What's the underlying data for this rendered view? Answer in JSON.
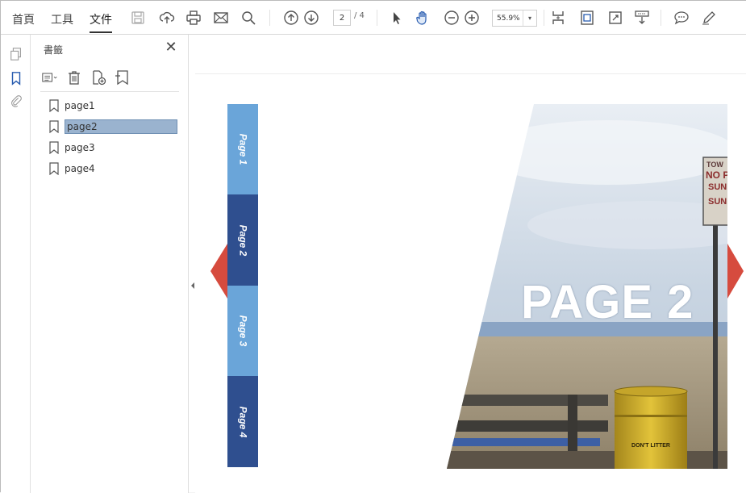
{
  "toolbar": {
    "tabs": [
      {
        "label": "首頁"
      },
      {
        "label": "工具"
      },
      {
        "label": "文件"
      }
    ],
    "page_current": "2",
    "page_total": "/ 4",
    "zoom": "55.9%",
    "icons": [
      "save-icon",
      "upload-icon",
      "print-icon",
      "mail-icon",
      "search-icon",
      "prev-page-icon",
      "next-page-icon",
      "select-cursor-icon",
      "hand-tool-icon",
      "zoom-out-icon",
      "zoom-in-icon",
      "fit-page-icon",
      "fit-width-icon",
      "fullscreen-icon",
      "read-mode-icon",
      "comment-icon",
      "sign-icon"
    ]
  },
  "panel": {
    "title": "書籤",
    "bookmarks": [
      {
        "label": "page1"
      },
      {
        "label": "page2"
      },
      {
        "label": "page3"
      },
      {
        "label": "page4"
      }
    ],
    "selected_index": 1
  },
  "slide": {
    "tabs": [
      {
        "label": "Page 1",
        "color": "#6aa5d9"
      },
      {
        "label": "Page 2",
        "color": "#2f4f8f"
      },
      {
        "label": "Page 3",
        "color": "#6aa5d9"
      },
      {
        "label": "Page 4",
        "color": "#2f4f8f"
      }
    ],
    "heading": "PAGE 2",
    "sign_lines": [
      "TOW",
      "NO PA",
      "SUN",
      "SUN"
    ],
    "barrel_text": "DON'T LITTER",
    "arrow_color": "#d64b3e"
  }
}
